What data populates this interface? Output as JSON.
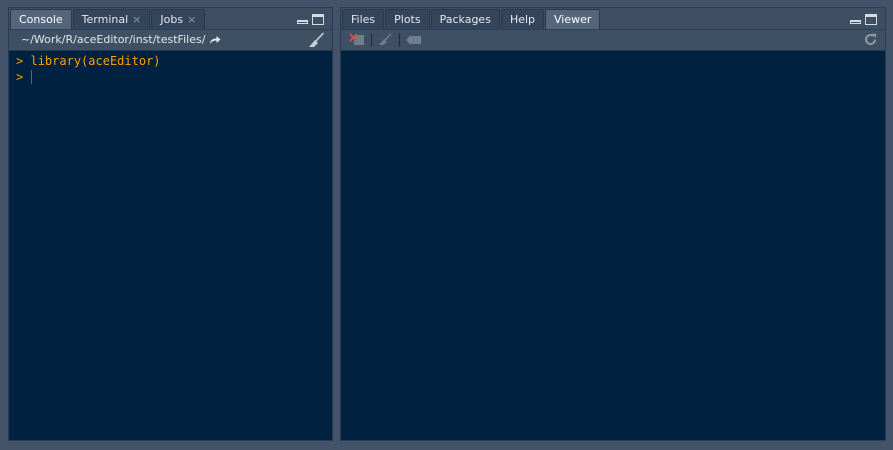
{
  "left_pane": {
    "tabs": [
      {
        "label": "Console",
        "closable": false,
        "active": true
      },
      {
        "label": "Terminal",
        "closable": true,
        "active": false
      },
      {
        "label": "Jobs",
        "closable": true,
        "active": false
      }
    ],
    "path": "~/Work/R/aceEditor/inst/testFiles/",
    "console": {
      "prompt": ">",
      "lines": [
        "library(aceEditor)",
        ""
      ]
    }
  },
  "right_pane": {
    "tabs": [
      {
        "label": "Files",
        "active": false
      },
      {
        "label": "Plots",
        "active": false
      },
      {
        "label": "Packages",
        "active": false
      },
      {
        "label": "Help",
        "active": false
      },
      {
        "label": "Viewer",
        "active": true
      }
    ]
  },
  "close_glyph": "×",
  "colors": {
    "background": "#002240",
    "chrome": "#43546a",
    "console_text": "#ff9d00"
  }
}
